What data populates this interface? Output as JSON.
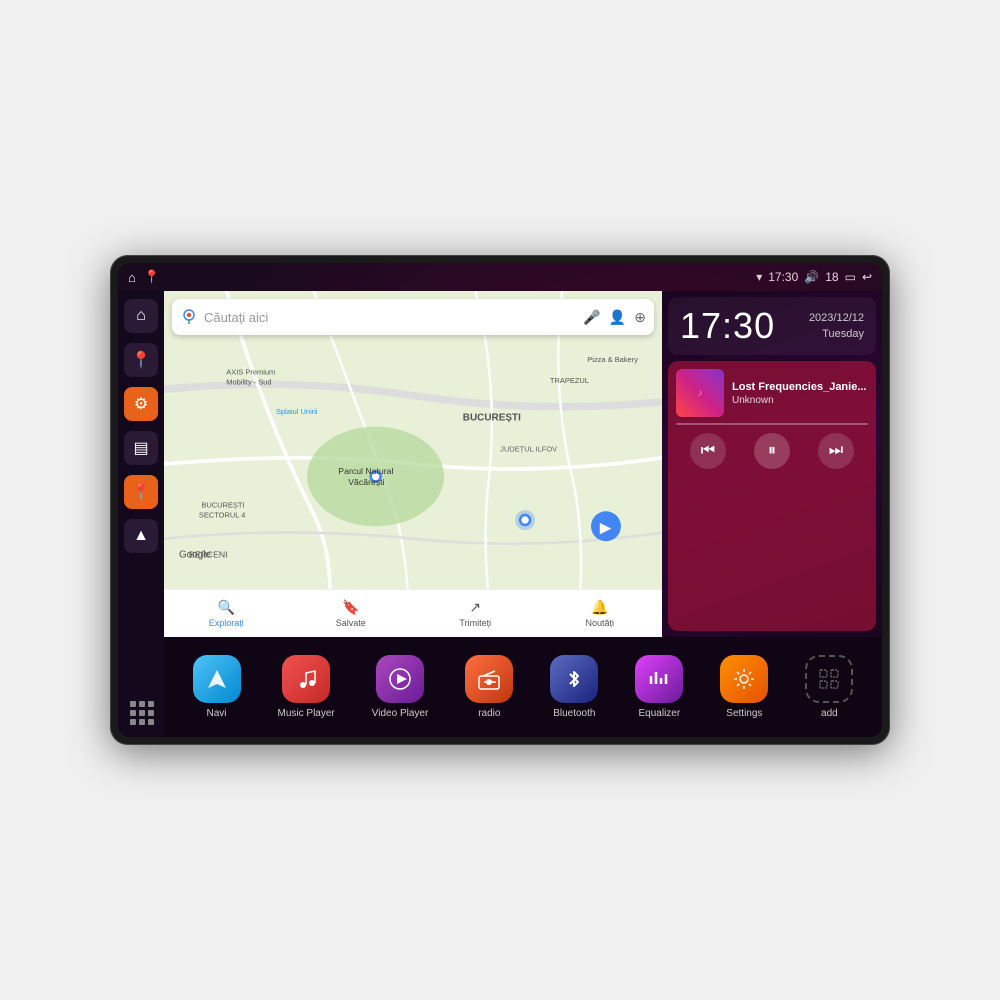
{
  "device": {
    "status_bar": {
      "wifi_icon": "▾",
      "time": "17:30",
      "volume_icon": "🔊",
      "battery_level": "18",
      "battery_icon": "🔋",
      "back_icon": "↩"
    },
    "clock": {
      "time": "17:30",
      "date_line1": "2023/12/12",
      "date_line2": "Tuesday"
    },
    "music": {
      "title": "Lost Frequencies_Janie...",
      "artist": "Unknown",
      "album_art_placeholder": "♪"
    },
    "controls": {
      "prev_label": "⏮",
      "play_pause_label": "⏸",
      "next_label": "⏭"
    },
    "map": {
      "search_placeholder": "Căutați aici",
      "locations": [
        "AXIS Premium Mobility - Sud",
        "Parcul Natural Văcărești",
        "Pizza & Bakery",
        "TRAPEZUL",
        "BUCUREȘTI",
        "JUDEȚUL ILFOV",
        "BUCUREȘTI SECTORUL 4",
        "BERCENI",
        "Splaiul Unirii"
      ],
      "bottom_items": [
        "Explorați",
        "Salvate",
        "Trimiteți",
        "Noutăți"
      ]
    },
    "apps": [
      {
        "id": "navi",
        "label": "Navi",
        "icon": "▲",
        "color_class": "navi"
      },
      {
        "id": "music-player",
        "label": "Music Player",
        "icon": "♪",
        "color_class": "music"
      },
      {
        "id": "video-player",
        "label": "Video Player",
        "icon": "▶",
        "color_class": "video"
      },
      {
        "id": "radio",
        "label": "radio",
        "icon": "📻",
        "color_class": "radio"
      },
      {
        "id": "bluetooth",
        "label": "Bluetooth",
        "icon": "⚡",
        "color_class": "bluetooth"
      },
      {
        "id": "equalizer",
        "label": "Equalizer",
        "icon": "≡",
        "color_class": "equalizer"
      },
      {
        "id": "settings",
        "label": "Settings",
        "icon": "⚙",
        "color_class": "settings"
      },
      {
        "id": "add",
        "label": "add",
        "icon": "+",
        "color_class": "add"
      }
    ],
    "sidebar": {
      "items": [
        {
          "id": "home",
          "icon": "⌂"
        },
        {
          "id": "maps",
          "icon": "📍"
        },
        {
          "id": "settings",
          "icon": "⚙"
        },
        {
          "id": "folder",
          "icon": "▤"
        },
        {
          "id": "location",
          "icon": "📍"
        },
        {
          "id": "navigation",
          "icon": "▲"
        }
      ]
    }
  }
}
